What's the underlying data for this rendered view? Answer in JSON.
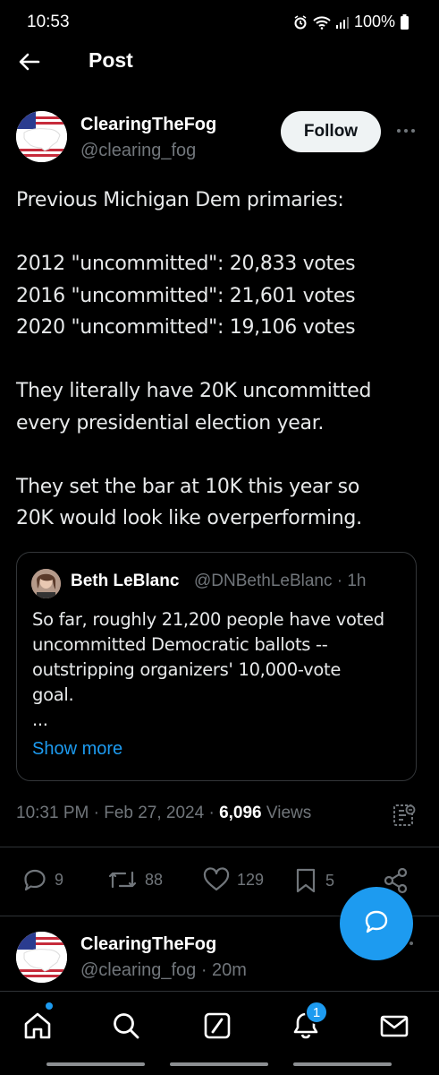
{
  "status_bar": {
    "time": "10:53",
    "battery": "100%"
  },
  "header": {
    "title": "Post"
  },
  "post": {
    "author_name": "ClearingTheFog",
    "author_handle": "@clearing_fog",
    "follow_label": "Follow",
    "lines": [
      "Previous Michigan Dem primaries:",
      "",
      "2012 \"uncommitted\": 20,833 votes",
      "2016 \"uncommitted\": 21,601 votes",
      "2020 \"uncommitted\": 19,106 votes",
      "",
      "They literally have 20K uncommitted",
      "every presidential election year.",
      "",
      "They set the bar at 10K this year so",
      "20K would look like overperforming."
    ],
    "quote": {
      "name": "Beth LeBlanc",
      "handle_time": "@DNBethLeBlanc · 1h",
      "text_lines": [
        "So far, roughly 21,200 people have voted",
        "uncommitted Democratic ballots --",
        "outstripping organizers' 10,000-vote",
        "goal.",
        "..."
      ],
      "show_more": "Show more"
    },
    "timestamp": "10:31 PM · Feb 27, 2024 · ",
    "views_count": "6,096",
    "views_label": " Views",
    "actions": {
      "replies": "9",
      "reposts": "88",
      "likes": "129",
      "bookmarks": "5"
    }
  },
  "reply": {
    "author_name": "ClearingTheFog",
    "author_handle_time": "@clearing_fog · 20m"
  },
  "bottom_nav": {
    "notifications_badge": "1"
  },
  "colors": {
    "accent": "#1d9bf0",
    "background": "#000000",
    "secondary_text": "#71767b"
  }
}
